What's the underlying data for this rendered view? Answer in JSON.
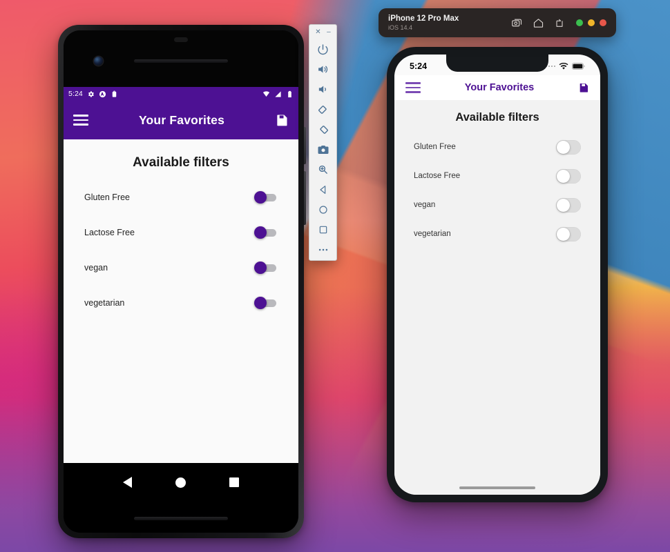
{
  "android": {
    "statusbar": {
      "time": "5:24",
      "icons": [
        "gear-icon",
        "circle-a-icon",
        "clipboard-icon",
        "wifi-icon",
        "cellular-icon",
        "battery-icon"
      ]
    },
    "appbar": {
      "menu_icon": "hamburger-menu-icon",
      "title": "Your Favorites",
      "save_icon": "floppy-disk-save-icon",
      "background": "#4d1193"
    },
    "heading": "Available filters",
    "filters": [
      {
        "label": "Gluten Free",
        "on": false
      },
      {
        "label": "Lactose Free",
        "on": false
      },
      {
        "label": "vegan",
        "on": false
      },
      {
        "label": "vegetarian",
        "on": false
      }
    ],
    "navbar": [
      "back-button",
      "home-button",
      "recents-button"
    ]
  },
  "emulator_toolbar": {
    "close_label": "✕",
    "minimize_label": "–",
    "buttons": [
      "power-button",
      "volume-up-button",
      "volume-down-button",
      "rotate-left-button",
      "rotate-right-button",
      "screenshot-camera-button",
      "zoom-button",
      "back-button",
      "home-button",
      "overview-button",
      "more-options-button"
    ]
  },
  "ios": {
    "window": {
      "device_name": "iPhone 12 Pro Max",
      "os_version": "iOS 14.4",
      "icons": [
        "screenshot-icon",
        "home-icon",
        "rotate-icon"
      ],
      "traffic_lights": [
        "#3bbf4f",
        "#f0b52a",
        "#e8574a"
      ]
    },
    "statusbar": {
      "time": "5:24",
      "icons": [
        "signal-dots-icon",
        "wifi-icon",
        "battery-icon"
      ]
    },
    "appbar": {
      "menu_icon": "hamburger-menu-icon",
      "title": "Your Favorites",
      "save_icon": "floppy-disk-save-icon",
      "accent": "#4d1193"
    },
    "heading": "Available filters",
    "filters": [
      {
        "label": "Gluten Free",
        "on": false
      },
      {
        "label": "Lactose Free",
        "on": false
      },
      {
        "label": "vegan",
        "on": false
      },
      {
        "label": "vegetarian",
        "on": false
      }
    ]
  }
}
